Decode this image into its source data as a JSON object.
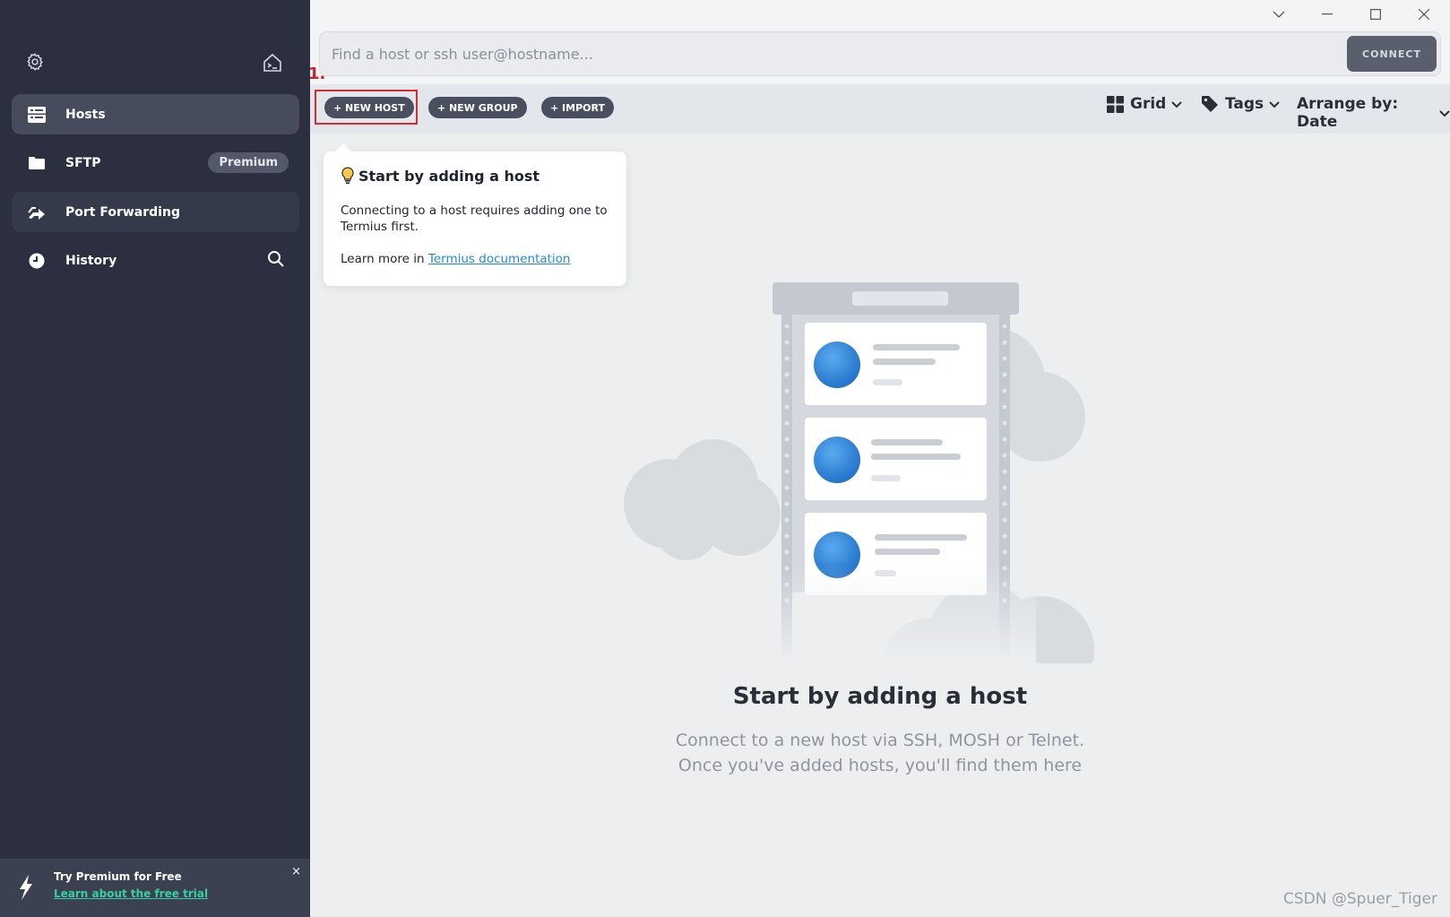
{
  "sidebar": {
    "items": [
      {
        "label": "Hosts",
        "icon": "hosts-icon"
      },
      {
        "label": "SFTP",
        "icon": "folder-icon",
        "badge": "Premium"
      },
      {
        "label": "Port Forwarding",
        "icon": "port-forward-icon"
      },
      {
        "label": "History",
        "icon": "history-icon"
      }
    ],
    "promo": {
      "title": "Try Premium for Free",
      "link": "Learn about the free trial",
      "close": "×"
    }
  },
  "search": {
    "placeholder": "Find a host or ssh user@hostname...",
    "connect_label": "CONNECT"
  },
  "toolbar": {
    "step_label": "1.",
    "new_host": "+ NEW HOST",
    "new_group": "+ NEW GROUP",
    "import": "+ IMPORT",
    "view_label": "Grid",
    "tags_label": "Tags",
    "arrange_label": "Arrange by: Date"
  },
  "tooltip": {
    "title": "Start by adding a host",
    "body": "Connecting to a host requires adding one to Termius first.",
    "more_prefix": "Learn more in ",
    "more_link": "Termius documentation"
  },
  "empty_state": {
    "title": "Start by adding a host",
    "line1": "Connect to a new host via SSH, MOSH or Telnet.",
    "line2": "Once you've added hosts, you'll find them here"
  },
  "watermark": "CSDN @Spuer_Tiger",
  "colors": {
    "sidebar_bg": "#2b2f3f",
    "active_item": "#474c5c",
    "accent_green": "#35d0a0",
    "link_blue": "#1e88e5",
    "highlight_red": "#d62b33"
  }
}
